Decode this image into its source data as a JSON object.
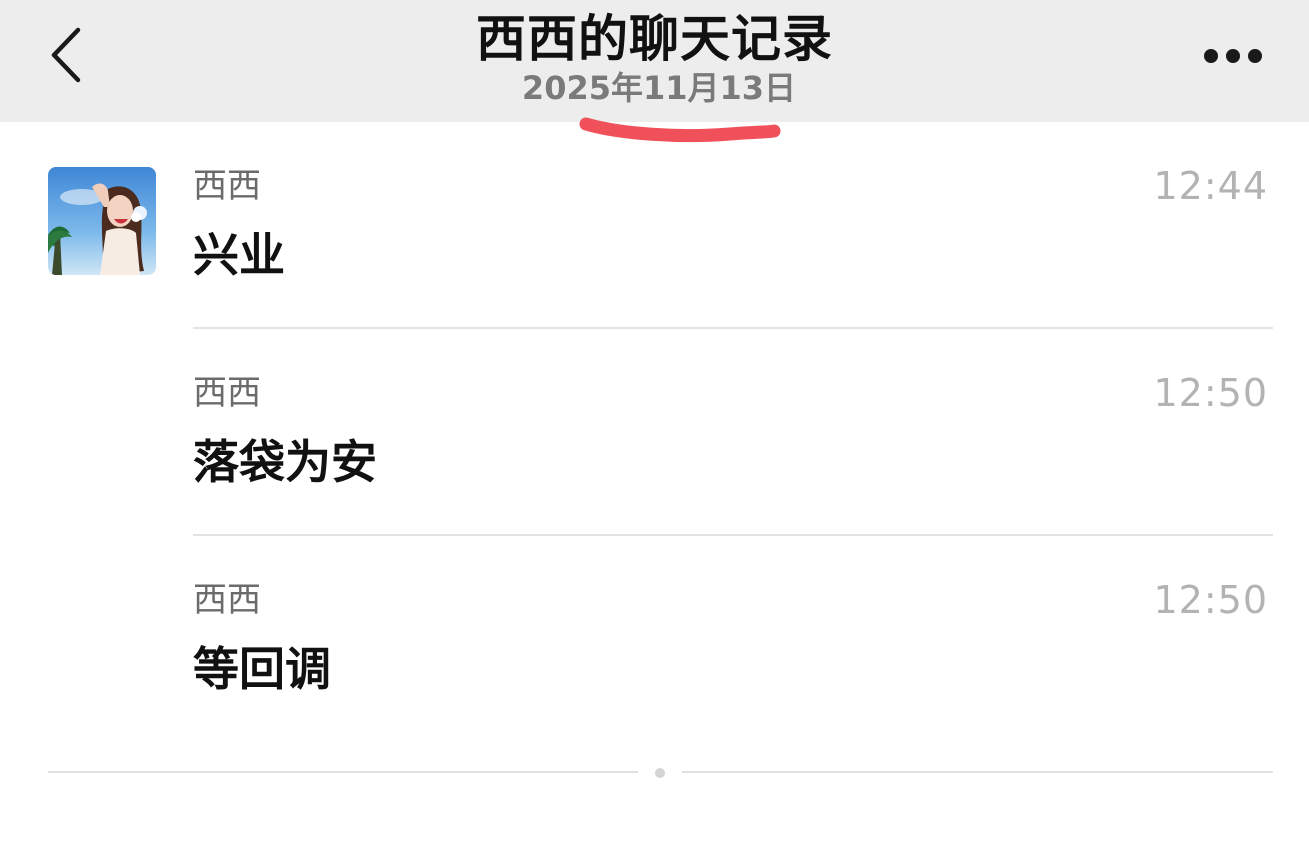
{
  "header": {
    "title": "西西的聊天记录",
    "date": "2025年11月13日"
  },
  "icons": {
    "back": "chevron-left-icon",
    "more": "more-dots-icon"
  },
  "colors": {
    "header_bg": "#ededed",
    "highlight_mark": "#f0505a"
  },
  "messages": [
    {
      "sender": "西西",
      "time": "12:44",
      "text": "兴业"
    },
    {
      "sender": "西西",
      "time": "12:50",
      "text": "落袋为安"
    },
    {
      "sender": "西西",
      "time": "12:50",
      "text": "等回调"
    }
  ]
}
